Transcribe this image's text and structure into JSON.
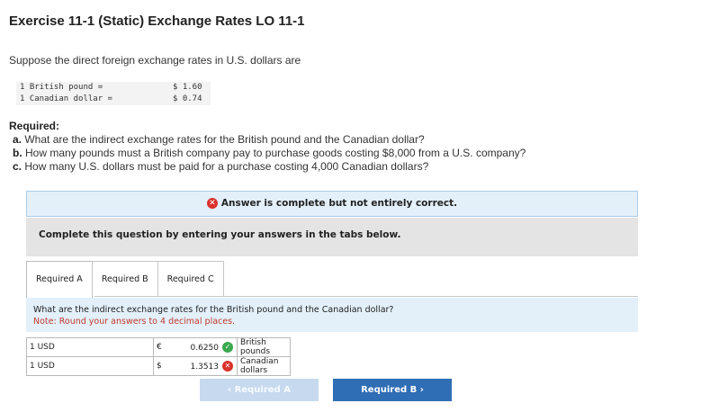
{
  "title": "Exercise 11-1 (Static) Exchange Rates LO 11-1",
  "intro": "Suppose the direct foreign exchange rates in U.S. dollars are",
  "rates": [
    {
      "label": "1 British pound =",
      "value": "$ 1.60"
    },
    {
      "label": "1 Canadian dollar =",
      "value": "$ 0.74"
    }
  ],
  "required_heading": "Required:",
  "questions": [
    {
      "letter": "a.",
      "text": "What are the indirect exchange rates for the British pound and the Canadian dollar?"
    },
    {
      "letter": "b.",
      "text": "How many pounds must a British company pay to purchase goods costing $8,000 from a U.S. company?"
    },
    {
      "letter": "c.",
      "text": "How many U.S. dollars must be paid for a purchase costing 4,000 Canadian dollars?"
    }
  ],
  "feedback": {
    "text": "Answer is complete but not entirely correct.",
    "icon": "x-circle-icon",
    "color": "#d9312b"
  },
  "instruction": "Complete this question by entering your answers in the tabs below.",
  "tabs": [
    {
      "label": "Required A",
      "active": true
    },
    {
      "label": "Required B",
      "active": false
    },
    {
      "label": "Required C",
      "active": false
    }
  ],
  "tab_panel": {
    "question": "What are the indirect exchange rates for the British pound and the Canadian dollar?",
    "note": "Note: Round your answers to 4 decimal places."
  },
  "answers": [
    {
      "from": "1 USD",
      "symbol": "€",
      "value": "0.6250",
      "status": "correct",
      "currency": "British pounds"
    },
    {
      "from": "1 USD",
      "symbol": "$",
      "value": "1.3513",
      "status": "incorrect",
      "currency": "Canadian dollars"
    }
  ],
  "nav": {
    "prev": "‹  Required A",
    "next": "Required B  ›"
  },
  "colors": {
    "accent": "#2f6db5",
    "correct": "#3aa94e",
    "incorrect": "#d9312b",
    "panel_bg": "#e3f0fa"
  }
}
